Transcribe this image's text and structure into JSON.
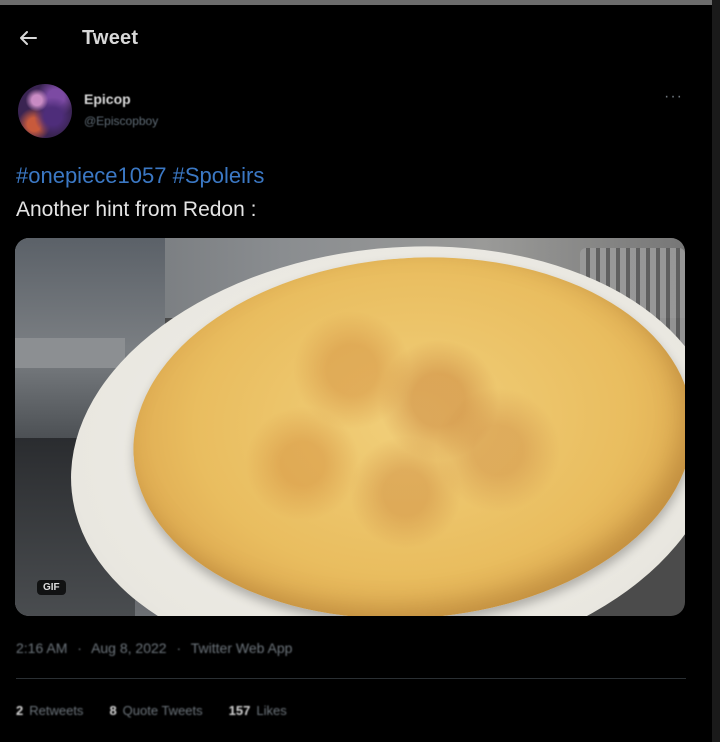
{
  "header": {
    "back_icon": "arrow-left-icon",
    "title": "Tweet"
  },
  "author": {
    "display_name": "Epicop",
    "handle": "@Episcopboy",
    "more_icon": "more-horizontal-icon",
    "more_label": "···"
  },
  "tweet": {
    "hashtags": [
      "#onepiece1057",
      "#Spoleirs"
    ],
    "text": "Another hint from Redon :",
    "media": {
      "type": "gif",
      "badge": "GIF"
    },
    "meta": {
      "time": "2:16 AM",
      "date": "Aug 8, 2022",
      "source": "Twitter Web App",
      "separator": "·"
    },
    "stats": [
      {
        "count": "2",
        "label": "Retweets"
      },
      {
        "count": "8",
        "label": "Quote Tweets"
      },
      {
        "count": "157",
        "label": "Likes"
      }
    ]
  },
  "colors": {
    "background": "#000000",
    "hashtag": "#3b78c4",
    "text": "#e4e4e4",
    "muted": "#6e767d"
  }
}
